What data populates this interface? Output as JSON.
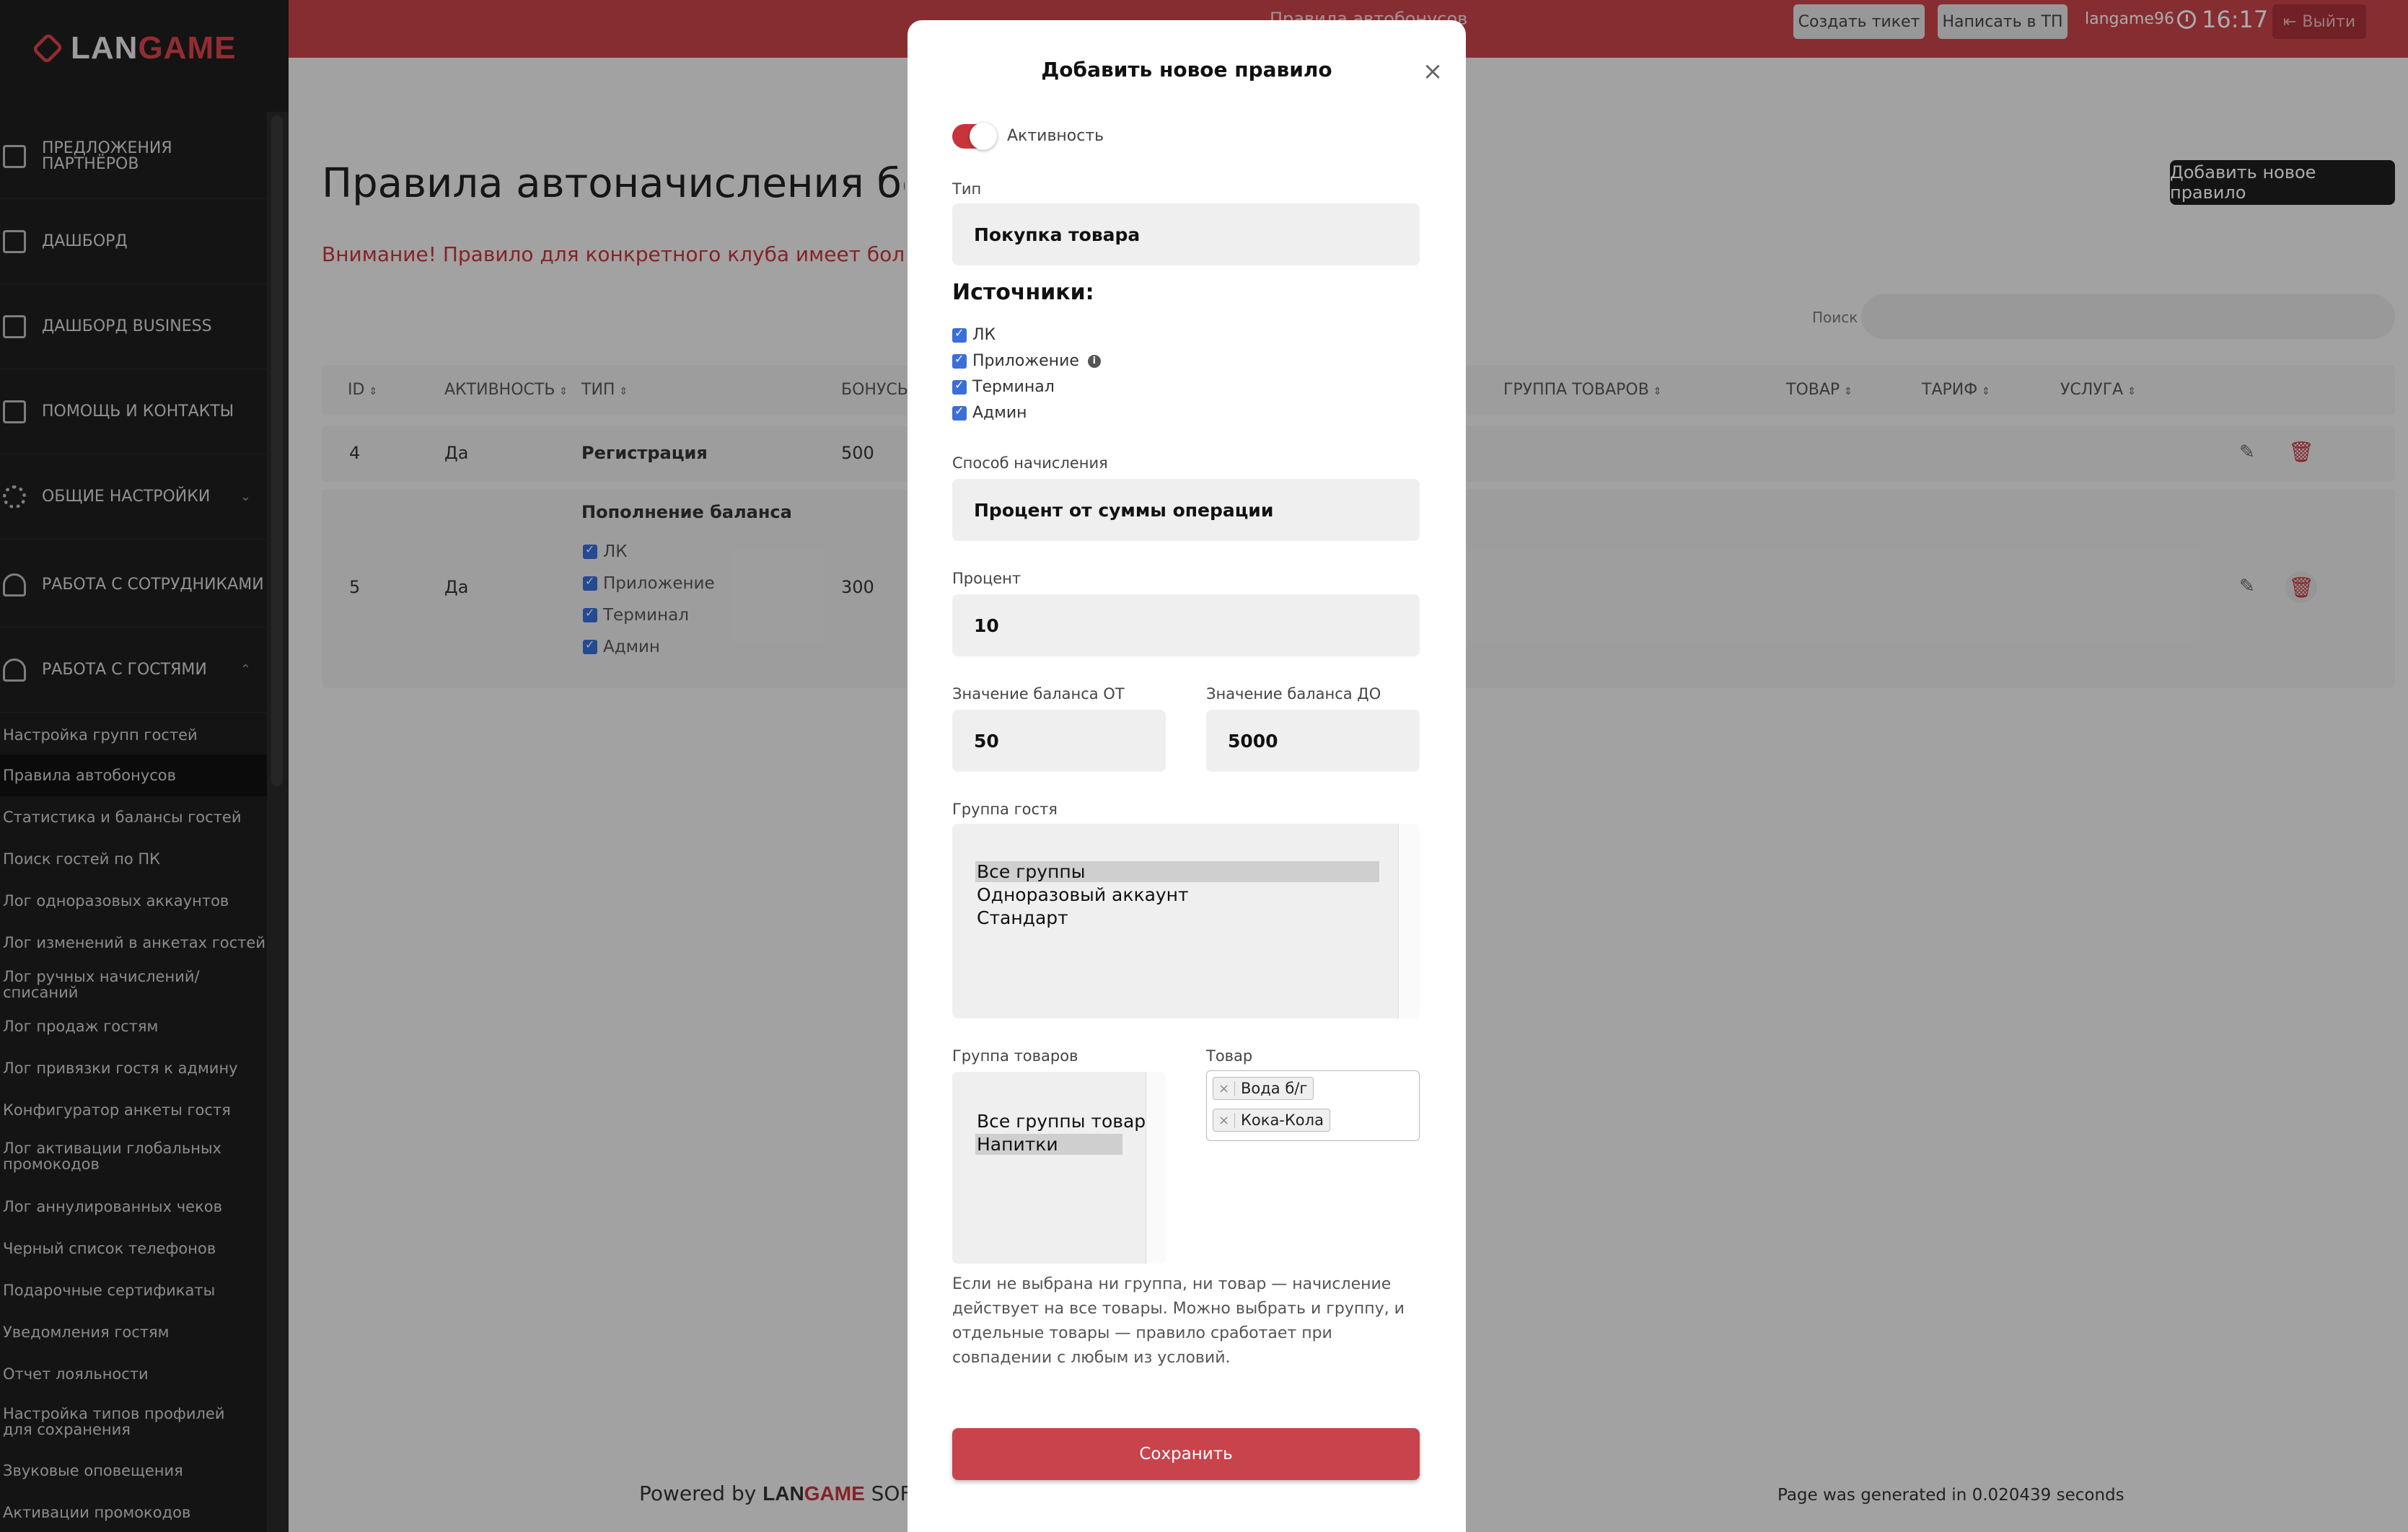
{
  "topbar": {
    "title": "Правила автобонусов",
    "create_ticket": "Создать тикет",
    "write_support": "Написать в ТП",
    "user": "langame96",
    "time": "16:17",
    "logout": "Выйти"
  },
  "sidebar": {
    "logo_white": "LAN",
    "logo_red": "GAME",
    "nav": [
      {
        "label": "Предложения партнёров",
        "icon": "partner-offers-icon"
      },
      {
        "label": "Дашборд",
        "icon": "dashboard-icon"
      },
      {
        "label": "Дашборд Business",
        "icon": "dashboard-business-icon"
      },
      {
        "label": "Помощь и контакты",
        "icon": "help-icon"
      },
      {
        "label": "Общие настройки",
        "icon": "gear-icon"
      },
      {
        "label": "Работа с сотрудниками",
        "icon": "employees-icon"
      },
      {
        "label": "Работа с гостями",
        "icon": "guests-icon"
      }
    ],
    "sub": [
      "Настройка групп гостей",
      "Правила автобонусов",
      "Статистика и балансы гостей",
      "Поиск гостей по ПК",
      "Лог одноразовых аккаунтов",
      "Лог изменений в анкетах гостей",
      "Лог ручных начислений/списаний",
      "Лог продаж гостям",
      "Лог привязки гостя к админу",
      "Конфигуратор анкеты гостя",
      "Лог активации глобальных промокодов",
      "Лог аннулированных чеков",
      "Черный список телефонов",
      "Подарочные сертификаты",
      "Уведомления гостям",
      "Отчет лояльности",
      "Настройка типов профилей для сохранения",
      "Звуковые оповещения",
      "Активации промокодов"
    ]
  },
  "main": {
    "title": "Правила автоначисления бонусов",
    "warning": "Внимание! Правило для конкретного клуба имеет более высокий приоритет",
    "add_button": "Добавить новое правило",
    "search_label": "Поиск",
    "columns": [
      "ID",
      "Активность",
      "Тип",
      "Бонусы",
      "Группа товаров",
      "Товар",
      "Тариф",
      "Услуга"
    ],
    "rows": [
      {
        "id": "4",
        "active": "Да",
        "type": "Регистрация",
        "bonus": "500"
      },
      {
        "id": "5",
        "active": "Да",
        "type": "Пополнение баланса",
        "bonus": "300",
        "sources": [
          "ЛК",
          "Приложение",
          "Терминал",
          "Админ"
        ]
      }
    ]
  },
  "footer": {
    "powered": "Powered by",
    "brand_white": "LAN",
    "brand_red": "GAME",
    "brand_suffix": "SOFT",
    "generated": "Page was generated in 0.020439 seconds"
  },
  "modal": {
    "title": "Добавить новое правило",
    "active_label": "Активность",
    "type_label": "Тип",
    "type_value": "Покупка товара",
    "sources_title": "Источники:",
    "sources": [
      "ЛК",
      "Приложение",
      "Терминал",
      "Админ"
    ],
    "method_label": "Способ начисления",
    "method_value": "Процент от суммы операции",
    "percent_label": "Процент",
    "percent_value": "10",
    "balance_from_label": "Значение баланса ОТ",
    "balance_from_value": "50",
    "balance_to_label": "Значение баланса ДО",
    "balance_to_value": "5000",
    "guest_group_label": "Группа гостя",
    "guest_groups": [
      "Все группы",
      "Одноразовый аккаунт",
      "Стандарт"
    ],
    "product_group_label": "Группа товаров",
    "product_groups": [
      "Все группы товаров",
      "Напитки"
    ],
    "product_label": "Товар",
    "products": [
      "Вода б/г",
      "Кока-Кола"
    ],
    "hint": "Если не выбрана ни группа, ни товар — начисление действует на все товары. Можно выбрать и группу, и отдельные товары — правило сработает при совпадении с любым из условий.",
    "save": "Сохранить"
  }
}
